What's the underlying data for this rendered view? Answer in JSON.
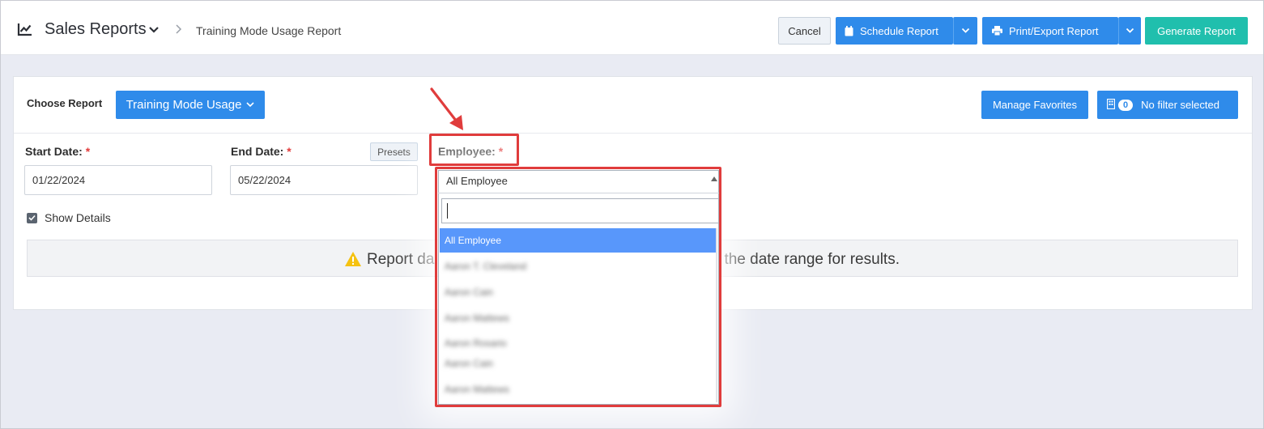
{
  "header": {
    "title": "Sales Reports",
    "breadcrumb": "Training Mode Usage Report",
    "buttons": {
      "cancel": "Cancel",
      "schedule": "Schedule Report",
      "print": "Print/Export Report",
      "generate": "Generate Report"
    }
  },
  "report": {
    "choose_label": "Choose Report",
    "selected": "Training Mode Usage",
    "manage_favorites": "Manage Favorites",
    "filter_count": "0",
    "filter_text": "No filter selected"
  },
  "form": {
    "start_label": "Start Date:",
    "start_value": "01/22/2024",
    "end_label": "End Date:",
    "end_value": "05/22/2024",
    "presets": "Presets",
    "employee_label": "Employee:",
    "required_mark": "*",
    "show_details": "Show Details",
    "show_details_checked": true
  },
  "alert": {
    "text_left": "Report da",
    "text_right": "the date range for results."
  },
  "employee_dropdown": {
    "selected": "All Employee",
    "search_value": "",
    "options": [
      "All Employee",
      "Aaron T. Cleveland",
      "Aaron Cain",
      "Aaron Mattews",
      "Aaron Rosario",
      "Aaron Cain",
      "Aaron Mattews"
    ]
  },
  "colors": {
    "primary_button": "#2f8bea",
    "generate_button": "#20bfad",
    "annotation": "#e03c3c",
    "selected_option": "#5897fb"
  }
}
